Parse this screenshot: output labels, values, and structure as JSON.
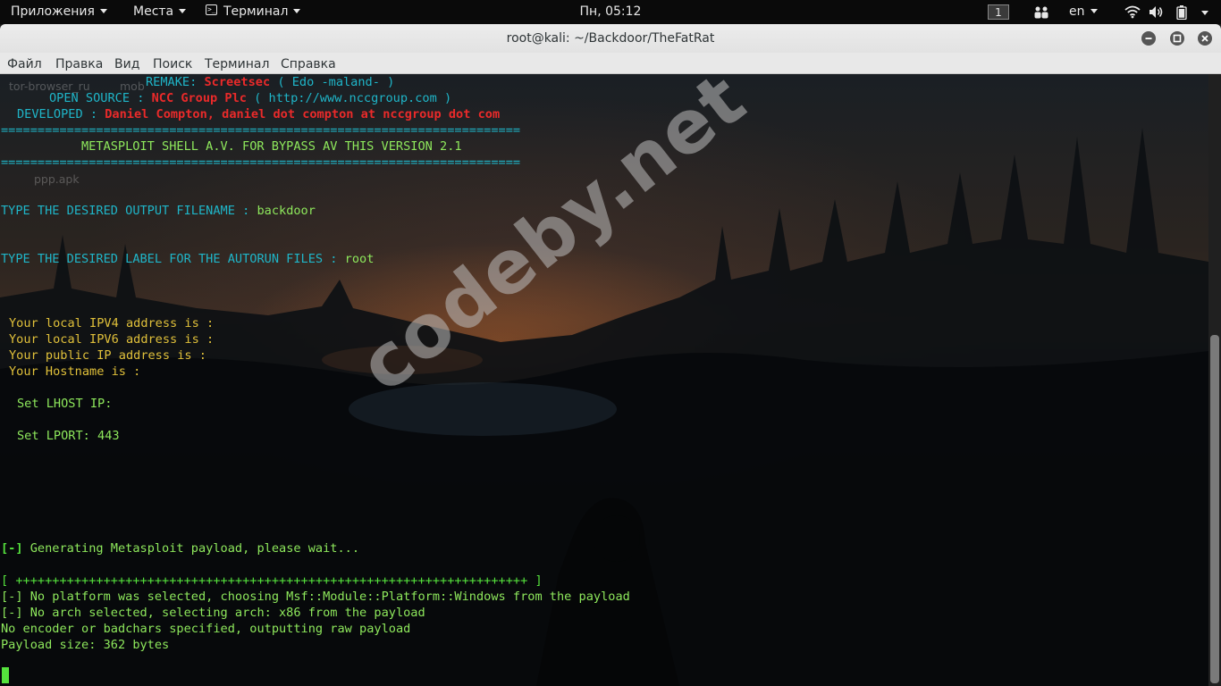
{
  "topbar": {
    "apps_label": "Приложения",
    "places_label": "Места",
    "terminal_label": "Терминал",
    "clock": "Пн, 05:12",
    "workspace": "1",
    "language": "en"
  },
  "window": {
    "title": "root@kali: ~/Backdoor/TheFatRat"
  },
  "menubar": {
    "file": "Файл",
    "edit": "Правка",
    "view": "Вид",
    "search": "Поиск",
    "terminal": "Терминал",
    "help": "Справка"
  },
  "desktop_ghost": {
    "item1": "tor-browser_ru",
    "item2": "mob",
    "item3": "ppp.apk"
  },
  "terminal": {
    "remake_label": "REMAKE: ",
    "remake_author": "Screetsec",
    "remake_alias": " ( Edo -maland- )",
    "opensource_label": "OPEN SOURCE : ",
    "opensource_org": "NCC Group Plc",
    "opensource_url": " ( http://www.nccgroup.com )",
    "developed_label": "DEVELOPED : ",
    "developed_author": "Daniel Compton, daniel dot compton at nccgroup dot com",
    "separator1": "=======================================================================",
    "banner": "METASPLOIT SHELL A.V. FOR BYPASS AV THIS VERSION 2.1",
    "separator2": "=======================================================================",
    "output_prompt": "TYPE THE DESIRED OUTPUT FILENAME : ",
    "output_value": "backdoor",
    "label_prompt": "TYPE THE DESIRED LABEL FOR THE AUTORUN FILES : ",
    "label_value": "root",
    "ipv4": "Your local IPV4 address is :",
    "ipv6": "Your local IPV6 address is :",
    "public_ip": "Your public IP address is :",
    "hostname": "Your Hostname is :",
    "lhost": "Set LHOST IP:",
    "lport": "Set LPORT: 443",
    "gen_tag": "[-]",
    "gen_text": " Generating Metasploit payload, please wait...",
    "progress": "[ ++++++++++++++++++++++++++++++++++++++++++++++++++++++++++++++++++++++ ]",
    "platform": "[-] No platform was selected, choosing Msf::Module::Platform::Windows from the payload",
    "arch": "[-] No arch selected, selecting arch: x86 from the payload",
    "encoder": "No encoder or badchars specified, outputting raw payload",
    "size": "Payload size: 362 bytes"
  },
  "watermark": "codeby.net",
  "colors": {
    "cyan": "#1fb5c8",
    "red": "#ea2a2a",
    "yellow": "#e0c03a",
    "green": "#55e23d"
  },
  "icons": {
    "terminal_app": "terminal-icon",
    "network": "wifi-icon",
    "sound": "volume-icon",
    "battery": "battery-icon",
    "people": "accessibility-icon",
    "minimize": "minimize-icon",
    "maximize": "maximize-icon",
    "close": "close-icon"
  }
}
